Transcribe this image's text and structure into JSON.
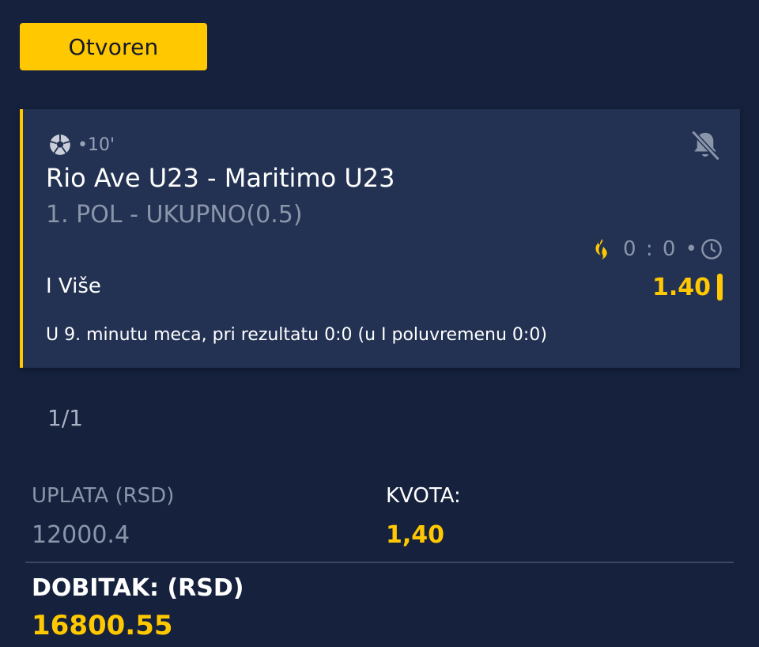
{
  "ticket": {
    "status_label": "Otvoren"
  },
  "event": {
    "sport_icon": "soccer-ball-icon",
    "minute": "•10'",
    "notification_icon": "bell-off-icon",
    "title": "Rio Ave U23 - Maritimo U23",
    "market": "1. POL - UKUPNO(0.5)",
    "live_icon": "flame-icon",
    "score": "0 : 0 •",
    "clock_icon": "clock-icon",
    "pick": "I Više",
    "odd": "1.40",
    "note": "U 9. minutu meca, pri rezultatu 0:0 (u I poluvremenu 0:0)"
  },
  "pager": "1/1",
  "summary": {
    "stake_label": "UPLATA (RSD)",
    "stake_value": "12000.4",
    "odds_label": "KVOTA:",
    "odds_value": "1,40",
    "win_label": "DOBITAK: (RSD)",
    "win_value": "16800.55"
  },
  "colors": {
    "background": "#15213d",
    "card": "#233253",
    "accent": "#ffc800",
    "muted_text": "#8b95aa"
  }
}
